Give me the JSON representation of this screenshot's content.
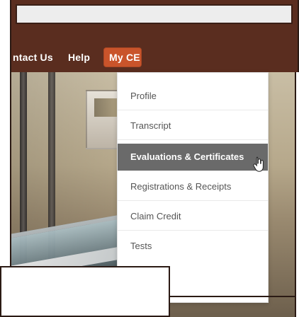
{
  "nav": {
    "items": [
      {
        "label": "ntact Us"
      },
      {
        "label": "Help"
      },
      {
        "label": "My CE"
      }
    ]
  },
  "dropdown": {
    "items": [
      {
        "label": "Profile"
      },
      {
        "label": "Transcript"
      },
      {
        "label": "Evaluations & Certificates"
      },
      {
        "label": "Registrations & Receipts"
      },
      {
        "label": "Claim Credit"
      },
      {
        "label": "Tests"
      }
    ],
    "active_index": 2
  },
  "colors": {
    "nav_bg": "#5a2d1f",
    "myce_active_bg": "#c9542b",
    "dropdown_active_bg": "#6a6a6a"
  },
  "icons": {
    "cursor": "hand-pointer-icon"
  }
}
